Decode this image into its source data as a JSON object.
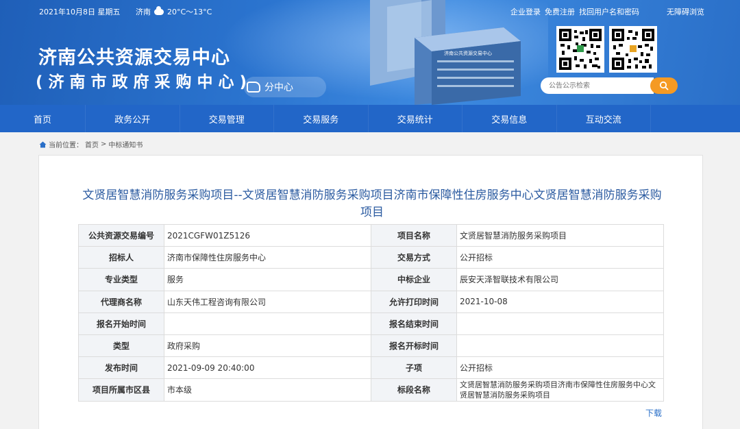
{
  "topbar": {
    "date": "2021年10月8日 星期五",
    "city": "济南",
    "temp": "20°C～13°C",
    "links": [
      "企业登录",
      "免费注册",
      "找回用户名和密码"
    ],
    "accessibility": "无障碍浏览"
  },
  "header": {
    "title_main": "济南公共资源交易中心",
    "title_sub": "(济南市政府采购中心)",
    "subcenter": "分中心",
    "building_sign": "济南公共资源交易中心",
    "search_placeholder": "公告公示检索"
  },
  "nav": [
    "首页",
    "政务公开",
    "交易管理",
    "交易服务",
    "交易统计",
    "交易信息",
    "互动交流"
  ],
  "breadcrumb": {
    "prefix": "当前位置：",
    "home": "首页",
    "sep": ">",
    "current": "中标通知书"
  },
  "doc": {
    "title": "文贤居智慧消防服务采购项目--文贤居智慧消防服务采购项目济南市保障性住房服务中心文贤居智慧消防服务采购项目",
    "rows": [
      [
        "公共资源交易编号",
        "2021CGFW01Z5126",
        "项目名称",
        "文贤居智慧消防服务采购项目"
      ],
      [
        "招标人",
        "济南市保障性住房服务中心",
        "交易方式",
        "公开招标"
      ],
      [
        "专业类型",
        "服务",
        "中标企业",
        "辰安天泽智联技术有限公司"
      ],
      [
        "代理商名称",
        "山东天伟工程咨询有限公司",
        "允许打印时间",
        "2021-10-08"
      ],
      [
        "报名开始时间",
        "",
        "报名结束时间",
        ""
      ],
      [
        "类型",
        "政府采购",
        "报名开标时间",
        ""
      ],
      [
        "发布时间",
        "2021-09-09 20:40:00",
        "子项",
        "公开招标"
      ],
      [
        "项目所属市区县",
        "市本级",
        "标段名称",
        "文贤居智慧消防服务采购项目济南市保障性住房服务中心文贤居智慧消防服务采购项目"
      ]
    ],
    "download": "下载"
  },
  "colors": {
    "nav_bg": "#2266c8",
    "title_text": "#2a5aa0",
    "search_button": "#f59a23"
  }
}
